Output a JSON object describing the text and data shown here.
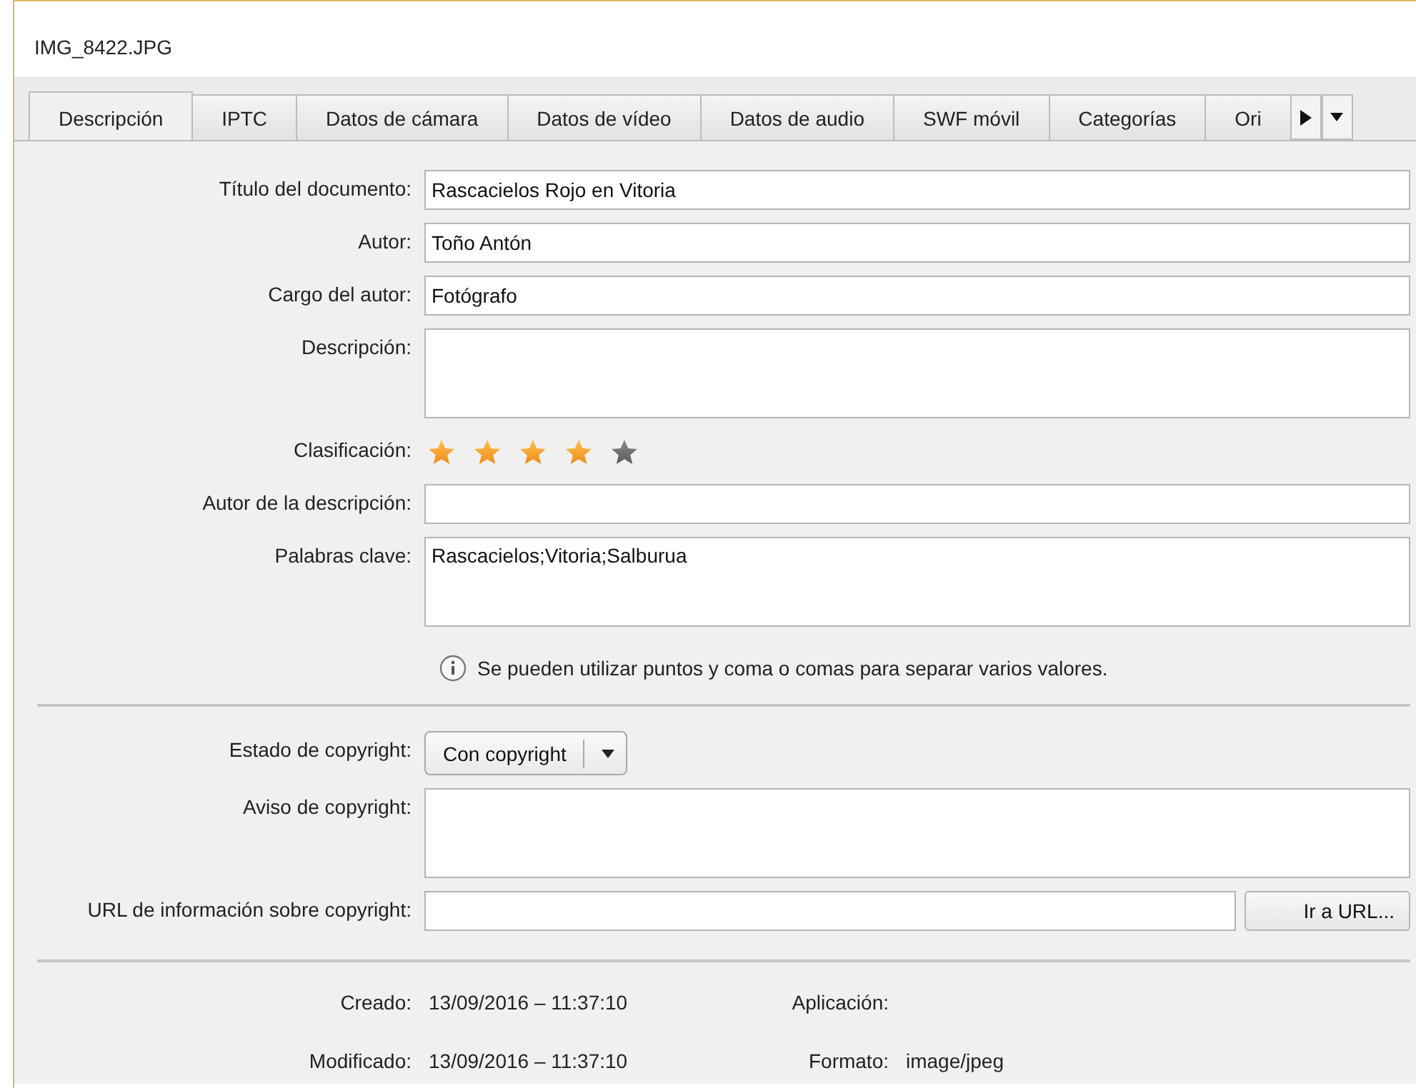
{
  "window": {
    "title": "IMG_8422.JPG"
  },
  "tabs": [
    {
      "label": "Descripción",
      "selected": true
    },
    {
      "label": "IPTC",
      "selected": false
    },
    {
      "label": "Datos de cámara",
      "selected": false
    },
    {
      "label": "Datos de vídeo",
      "selected": false
    },
    {
      "label": "Datos de audio",
      "selected": false
    },
    {
      "label": "SWF móvil",
      "selected": false
    },
    {
      "label": "Categorías",
      "selected": false
    },
    {
      "label": "Ori",
      "selected": false
    }
  ],
  "fields": [
    {
      "kind": "text",
      "label": "Título del documento:",
      "value": "Rascacielos Rojo en Vitoria"
    },
    {
      "kind": "text",
      "label": "Autor:",
      "value": "Toño Antón"
    },
    {
      "kind": "text",
      "label": "Cargo del autor:",
      "value": "Fotógrafo"
    },
    {
      "kind": "area",
      "label": "Descripción:"
    },
    {
      "kind": "rating",
      "label": "Clasificación:",
      "stars": 4
    },
    {
      "kind": "text",
      "label": "Autor de la descripción:"
    },
    {
      "kind": "area",
      "label": "Palabras clave:",
      "value": "Rascacielos;Vitoria;Salburua"
    }
  ],
  "hint": "Se pueden utilizar puntos y coma o comas para separar varios valores.",
  "copyright": [
    {
      "kind": "dropdown",
      "label": "Estado de copyright:",
      "value": "Con copyright"
    },
    {
      "kind": "area",
      "label": "Aviso de copyright:"
    },
    {
      "kind": "url",
      "label": "URL de información sobre copyright:",
      "button": "Ir a URL..."
    }
  ],
  "dates": [
    {
      "label": "Creado:",
      "value": "13/09/2016 – 11:37:10"
    },
    {
      "label": "Modificado:",
      "value": "13/09/2016 – 11:37:10"
    }
  ],
  "file_info": [
    {
      "label": "Aplicación:"
    },
    {
      "label": "Formato:",
      "value": "image/jpeg"
    }
  ]
}
